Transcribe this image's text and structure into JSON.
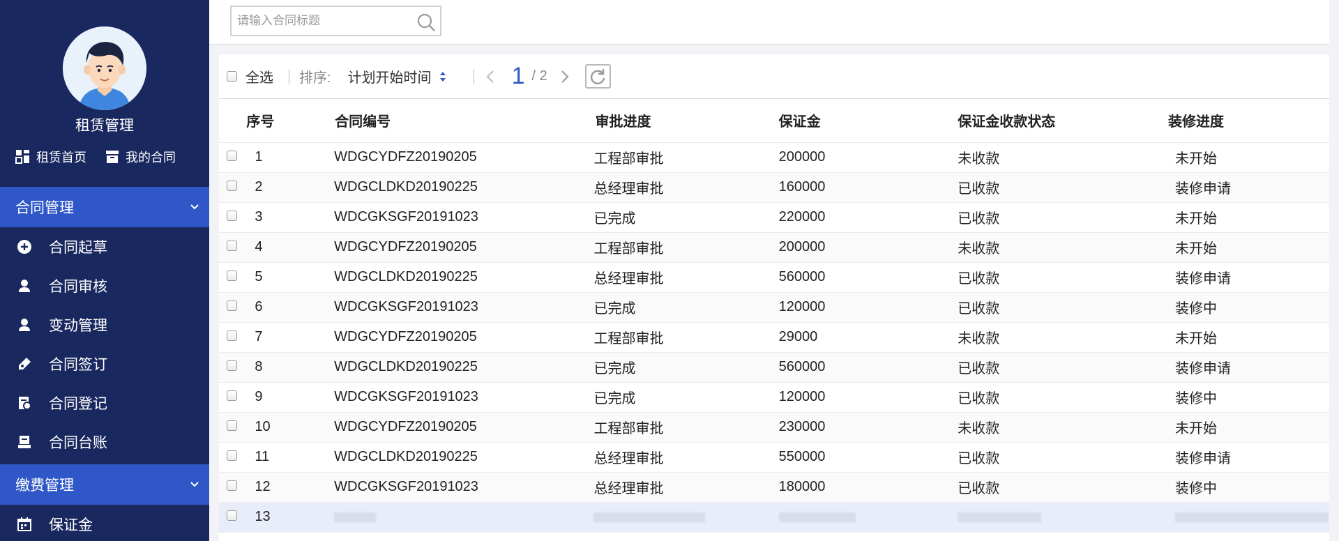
{
  "profile": {
    "name": "租赁管理"
  },
  "quick_links": [
    {
      "label": "租赁首页",
      "icon": "dashboard-icon"
    },
    {
      "label": "我的合同",
      "icon": "archive-icon"
    }
  ],
  "nav": {
    "group1": {
      "label": "合同管理",
      "expanded": true
    },
    "items": [
      {
        "label": "合同起草",
        "icon": "plus-circle-icon"
      },
      {
        "label": "合同审核",
        "icon": "user-icon"
      },
      {
        "label": "变动管理",
        "icon": "user-icon"
      },
      {
        "label": "合同签订",
        "icon": "pen-icon"
      },
      {
        "label": "合同登记",
        "icon": "document-register-icon"
      },
      {
        "label": "合同台账",
        "icon": "ledger-icon"
      }
    ],
    "group2": {
      "label": "缴费管理",
      "expanded": true
    },
    "items2": [
      {
        "label": "保证金",
        "icon": "calendar-icon"
      }
    ]
  },
  "search": {
    "placeholder": "请输入合同标题",
    "value": ""
  },
  "toolbar": {
    "select_all": "全选",
    "sort_label": "排序:",
    "sort_value": "计划开始时间",
    "page_current": "1",
    "page_total": "/ 2"
  },
  "table": {
    "headers": [
      "序号",
      "合同编号",
      "审批进度",
      "保证金",
      "保证金收款状态",
      "装修进度"
    ],
    "rows": [
      [
        "1",
        "WDGCYDFZ20190205",
        "工程部审批",
        "200000",
        "未收款",
        "未开始"
      ],
      [
        "2",
        "WDGCLDKD20190225",
        "总经理审批",
        "160000",
        "已收款",
        "装修申请"
      ],
      [
        "3",
        "WDCGKSGF20191023",
        "已完成",
        "220000",
        "已收款",
        "未开始"
      ],
      [
        "4",
        "WDGCYDFZ20190205",
        "工程部审批",
        "200000",
        "未收款",
        "未开始"
      ],
      [
        "5",
        "WDGCLDKD20190225",
        "总经理审批",
        "560000",
        "已收款",
        "装修申请"
      ],
      [
        "6",
        "WDCGKSGF20191023",
        "已完成",
        "120000",
        "已收款",
        "装修中"
      ],
      [
        "7",
        "WDGCYDFZ20190205",
        "工程部审批",
        "29000",
        "未收款",
        "未开始"
      ],
      [
        "8",
        "WDGCLDKD20190225",
        "已完成",
        "560000",
        "已收款",
        "装修申请"
      ],
      [
        "9",
        "WDCGKSGF20191023",
        "已完成",
        "120000",
        "已收款",
        "装修中"
      ],
      [
        "10",
        "WDGCYDFZ20190205",
        "工程部审批",
        "230000",
        "未收款",
        "未开始"
      ],
      [
        "11",
        "WDGCLDKD20190225",
        "总经理审批",
        "550000",
        "已收款",
        "装修申请"
      ],
      [
        "12",
        "WDCGKSGF20191023",
        "总经理审批",
        "180000",
        "已收款",
        "装修中"
      ],
      [
        "13",
        "",
        "",
        "",
        "",
        ""
      ]
    ]
  },
  "colors": {
    "sidebar": "#19285f",
    "accent": "#2f57c7"
  }
}
